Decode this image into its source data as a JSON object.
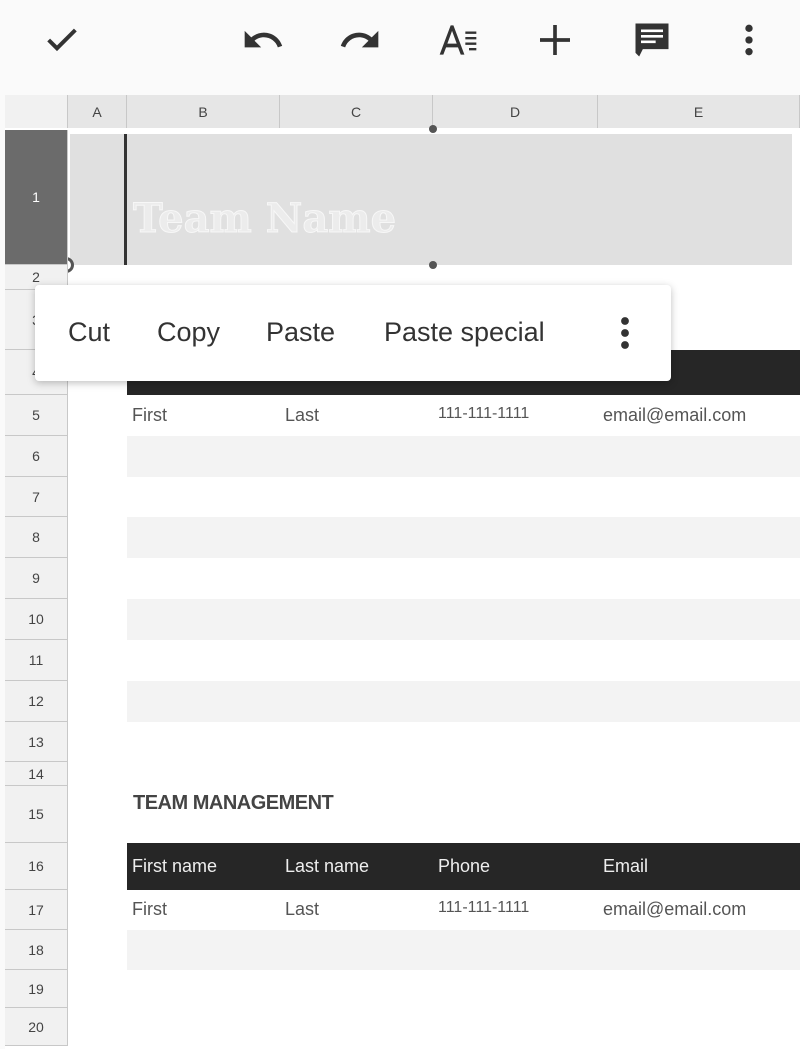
{
  "toolbar": {
    "icons": [
      "check-icon",
      "undo-icon",
      "redo-icon",
      "text-format-icon",
      "insert-icon",
      "comment-icon",
      "more-vert-icon"
    ]
  },
  "columns": [
    "A",
    "B",
    "C",
    "D",
    "E"
  ],
  "rows": [
    "1",
    "2",
    "3",
    "4",
    "5",
    "6",
    "7",
    "8",
    "9",
    "10",
    "11",
    "12",
    "13",
    "14",
    "15",
    "16",
    "17",
    "18",
    "19",
    "20"
  ],
  "selected_row": "1",
  "title_cell": "Team Name",
  "section_title": "TEAM MANAGEMENT",
  "table_headers": [
    "First name",
    "Last name",
    "Phone",
    "Email"
  ],
  "row5": [
    "First",
    "Last",
    "111-111-1111",
    "email@email.com"
  ],
  "row17": [
    "First",
    "Last",
    "111-111-1111",
    "email@email.com"
  ],
  "context_menu": {
    "items": [
      "Cut",
      "Copy",
      "Paste",
      "Paste special"
    ],
    "more": "more-vert-icon"
  },
  "colors": {
    "header_band": "#262626",
    "selection": "#e0e0e0",
    "row_header_selected": "#6b6b6b"
  }
}
